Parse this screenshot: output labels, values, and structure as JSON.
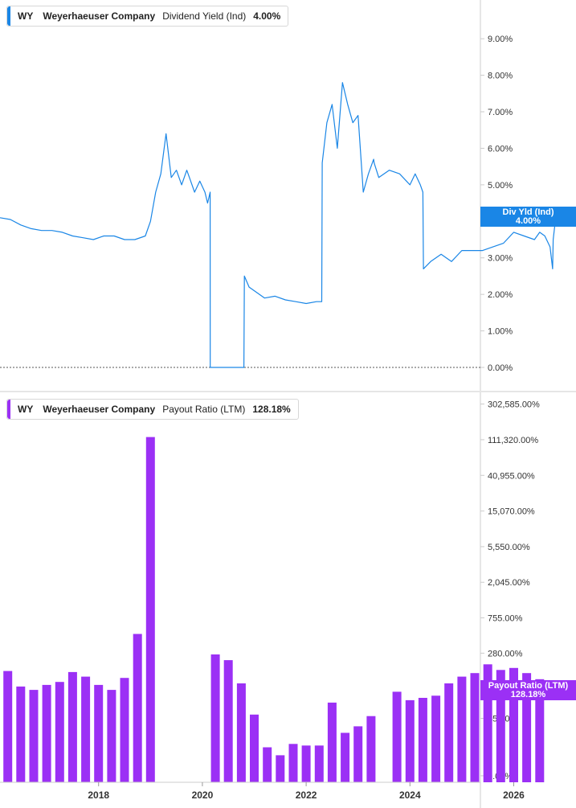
{
  "colors": {
    "yield_line": "#1a86e6",
    "payout_bar": "#9b30f5",
    "axis": "#cccccc",
    "zero_line": "#555555"
  },
  "legend_top": {
    "ticker": "WY",
    "company": "Weyerhaeuser Company",
    "metric": "Dividend Yield (Ind)",
    "value": "4.00%"
  },
  "legend_bottom": {
    "ticker": "WY",
    "company": "Weyerhaeuser Company",
    "metric": "Payout Ratio (LTM)",
    "value": "128.18%"
  },
  "flag_top": {
    "label": "Div Yld (Ind)",
    "value": "4.00%"
  },
  "flag_bottom": {
    "label": "Payout Ratio (LTM)",
    "value": "128.18%"
  },
  "chart_data": [
    {
      "type": "line",
      "series": [
        {
          "name": "Dividend Yield (Ind)",
          "x": [
            2016.1,
            2016.3,
            2016.5,
            2016.7,
            2016.9,
            2017.1,
            2017.3,
            2017.5,
            2017.7,
            2017.9,
            2018.1,
            2018.3,
            2018.5,
            2018.7,
            2018.9,
            2019.0,
            2019.1,
            2019.2,
            2019.3,
            2019.4,
            2019.5,
            2019.6,
            2019.7,
            2019.75,
            2019.85,
            2019.95,
            2020.05,
            2020.1,
            2020.15,
            2020.151,
            2020.7,
            2020.8,
            2020.81,
            2020.9,
            2021.0,
            2021.2,
            2021.4,
            2021.6,
            2021.8,
            2022.0,
            2022.2,
            2022.3,
            2022.31,
            2022.4,
            2022.5,
            2022.6,
            2022.7,
            2022.8,
            2022.9,
            2023.0,
            2023.1,
            2023.2,
            2023.3,
            2023.31,
            2023.4,
            2023.6,
            2023.8,
            2024.0,
            2024.1,
            2024.2,
            2024.25,
            2024.26,
            2024.4,
            2024.6,
            2024.8,
            2025.0,
            2025.2,
            2025.4,
            2025.6,
            2025.8,
            2026.0,
            2026.2,
            2026.4,
            2026.5,
            2026.6,
            2026.7,
            2026.75,
            2026.76,
            2026.8
          ],
          "values": [
            4.1,
            4.05,
            3.9,
            3.8,
            3.75,
            3.75,
            3.7,
            3.6,
            3.55,
            3.5,
            3.6,
            3.6,
            3.5,
            3.5,
            3.6,
            4.0,
            4.8,
            5.3,
            6.4,
            5.2,
            5.4,
            5.0,
            5.4,
            5.2,
            4.8,
            5.1,
            4.8,
            4.5,
            4.8,
            0,
            0,
            0,
            2.5,
            2.2,
            2.1,
            1.9,
            1.95,
            1.85,
            1.8,
            1.75,
            1.8,
            1.8,
            5.6,
            6.7,
            7.2,
            6.0,
            7.8,
            7.2,
            6.7,
            6.9,
            4.8,
            5.3,
            5.7,
            5.6,
            5.2,
            5.4,
            5.3,
            5.0,
            5.3,
            5.0,
            4.8,
            2.7,
            2.9,
            3.1,
            2.9,
            3.2,
            3.2,
            3.2,
            3.3,
            3.4,
            3.7,
            3.6,
            3.5,
            3.7,
            3.6,
            3.3,
            2.7,
            3.5,
            4.0
          ]
        }
      ],
      "ylim": [
        0,
        9.4
      ],
      "yticks": [
        "9.00%",
        "8.00%",
        "7.00%",
        "6.00%",
        "5.00%",
        "4.00%",
        "3.00%",
        "2.00%",
        "1.00%",
        "0.00%"
      ],
      "ytick_values": [
        9,
        8,
        7,
        6,
        5,
        4,
        3,
        2,
        1,
        0
      ],
      "xlim": [
        2016.1,
        2027.2
      ],
      "grid": false,
      "legend": "top-left"
    },
    {
      "type": "bar",
      "scale": "log",
      "series": [
        {
          "name": "Payout Ratio (LTM)",
          "x": [
            2016.25,
            2016.5,
            2016.75,
            2017.0,
            2017.25,
            2017.5,
            2017.75,
            2018.0,
            2018.25,
            2018.5,
            2018.75,
            2019.0,
            2019.25,
            2019.5,
            2020.25,
            2020.5,
            2020.75,
            2021.0,
            2021.25,
            2021.5,
            2021.75,
            2022.0,
            2022.25,
            2022.5,
            2022.75,
            2023.0,
            2023.25,
            2023.75,
            2024.0,
            2024.25,
            2024.5,
            2024.75,
            2025.0,
            2025.25,
            2025.5,
            2025.75,
            2026.0,
            2026.25,
            2026.5
          ],
          "values": [
            170,
            110,
            100,
            115,
            125,
            165,
            145,
            115,
            100,
            140,
            480,
            120000,
            0,
            0,
            270,
            230,
            120,
            50,
            20,
            16,
            22,
            21,
            21,
            70,
            30,
            36,
            48,
            95,
            75,
            80,
            85,
            120,
            145,
            160,
            205,
            175,
            185,
            160,
            135
          ]
        }
      ],
      "ylim": [
        7.5,
        420000
      ],
      "yticks": [
        "302,585.00%",
        "111,320.00%",
        "40,955.00%",
        "15,070.00%",
        "5,550.00%",
        "2,045.00%",
        "755.00%",
        "280.00%",
        "105.00%",
        "45.00%",
        "9.00%"
      ],
      "ytick_values": [
        302585,
        111320,
        40955,
        15070,
        5550,
        2045,
        755,
        280,
        105,
        45,
        9
      ],
      "xticks": [
        "2018",
        "2020",
        "2022",
        "2024",
        "2026"
      ],
      "xtick_values": [
        2018,
        2020,
        2022,
        2024,
        2026
      ],
      "xlim": [
        2016.1,
        2027.2
      ],
      "grid": false,
      "legend": "top-left"
    }
  ]
}
